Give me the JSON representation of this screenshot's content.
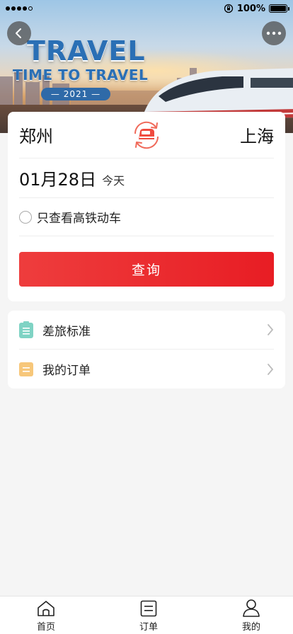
{
  "status_bar": {
    "battery_percent": "100%",
    "battery_level": 1.0
  },
  "banner": {
    "title": "TRAVEL",
    "subtitle": "TIME TO TRAVEL",
    "year": "— 2021 —"
  },
  "search": {
    "from_city": "郑州",
    "to_city": "上海",
    "date": "01月28日",
    "date_note": "今天",
    "high_speed_only_label": "只查看高铁动车",
    "high_speed_only_checked": false,
    "query_label": "查询"
  },
  "menu": {
    "items": [
      {
        "label": "差旅标准",
        "icon": "travel-standard-icon",
        "color": "#7fd3c4"
      },
      {
        "label": "我的订单",
        "icon": "my-orders-icon",
        "color": "#f7c77a"
      }
    ]
  },
  "tabbar": {
    "items": [
      {
        "label": "首页",
        "icon": "home-icon"
      },
      {
        "label": "订单",
        "icon": "orders-icon"
      },
      {
        "label": "我的",
        "icon": "profile-icon"
      }
    ]
  },
  "colors": {
    "accent_red": "#e81d24",
    "banner_blue": "#2a6fb5"
  }
}
